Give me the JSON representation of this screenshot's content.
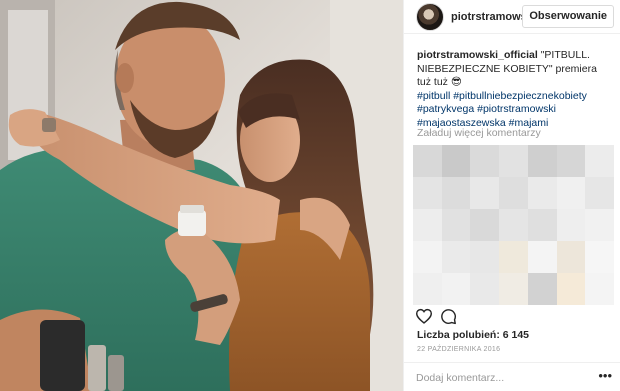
{
  "post": {
    "username": "piotrstramowski_official",
    "username_short": "piotrstramows",
    "follow_label": "Obserwowanie",
    "caption_text": "\"PITBULL. NIEBEZPIECZNE KOBIETY\" premiera tuż tuż 😎",
    "hashtags": [
      "#pitbull",
      "#pitbullniebezpiecznekobiety",
      "#patrykvega",
      "#piotrstramowski",
      "#majaostaszewska",
      "#majami"
    ],
    "load_more": "Załaduj więcej komentarzy",
    "likes": "Liczba polubień: 6 145",
    "date": "22 PAŹDZIERNIKA 2016",
    "comment_placeholder": "Dodaj komentarz...",
    "more_label": "•••"
  },
  "icons": {
    "like": "heart-icon",
    "comment": "comment-icon",
    "more": "more-options-icon"
  },
  "colors": {
    "link": "#003569",
    "muted": "#999999",
    "text": "#262626",
    "border": "#dbdbdb"
  }
}
